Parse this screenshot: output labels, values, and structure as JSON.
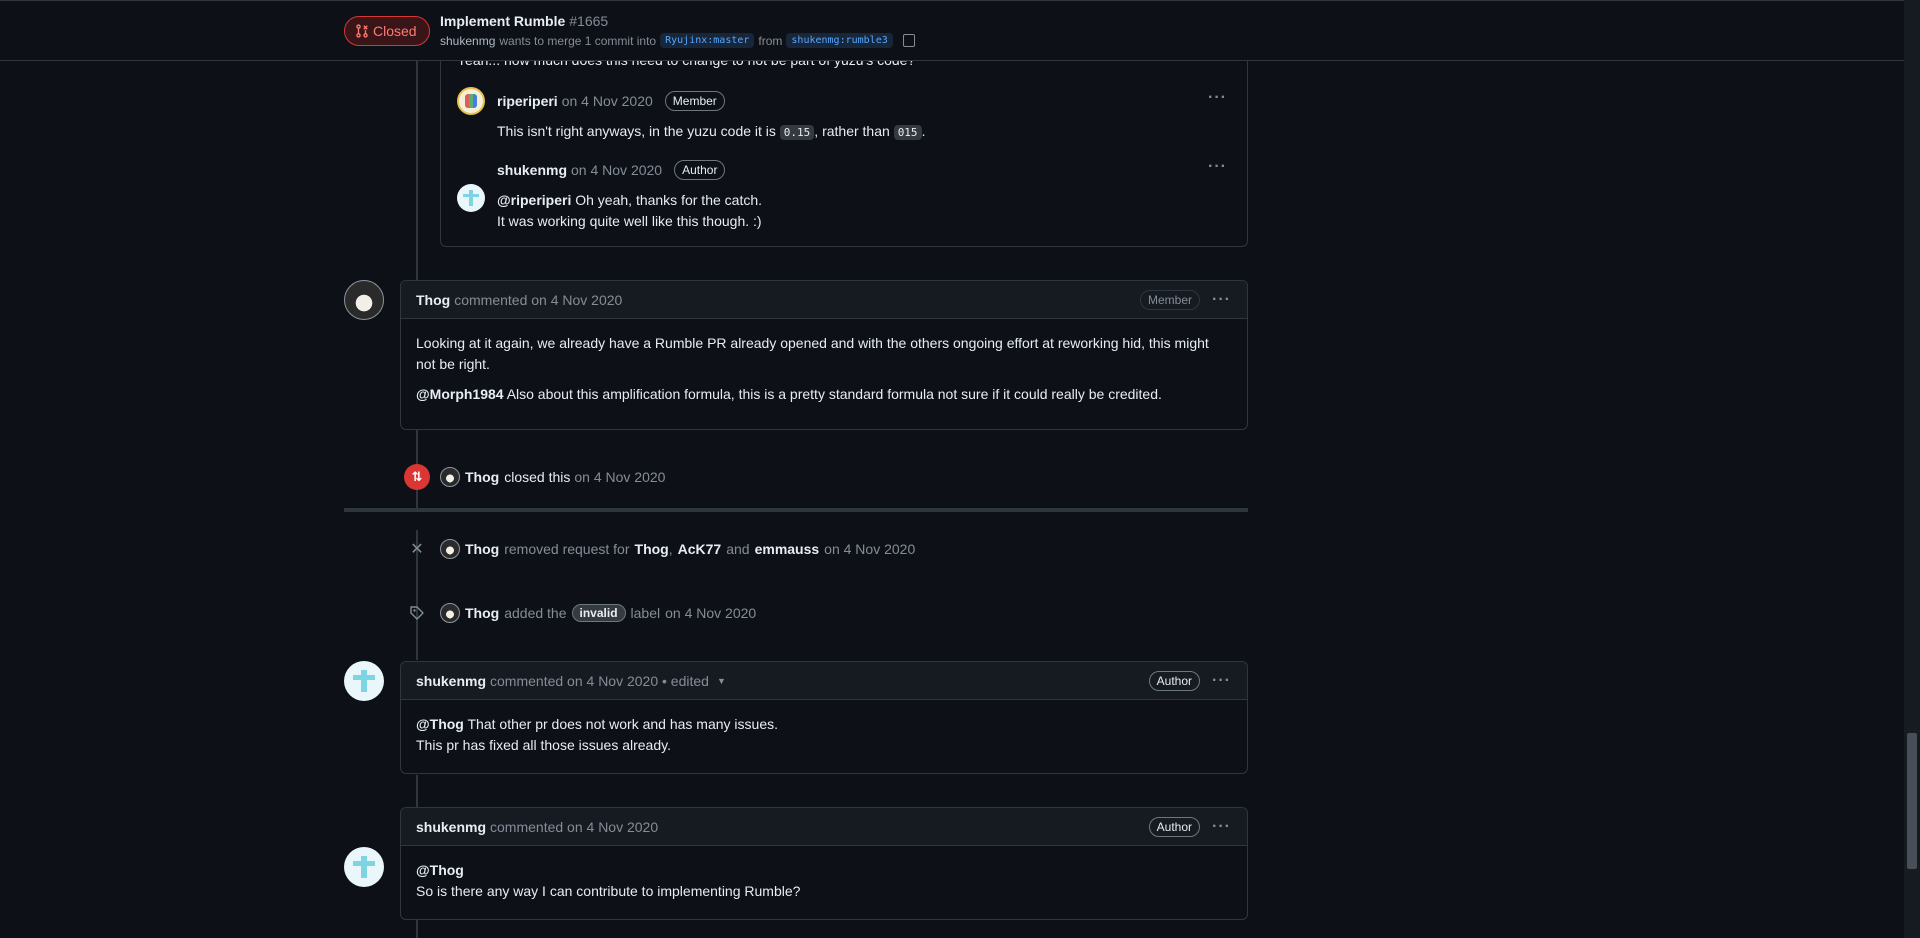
{
  "header": {
    "state": "Closed",
    "title": "Implement Rumble",
    "number": "#1665",
    "author": "shukenmg",
    "merge_text": "wants to merge 1 commit into",
    "base_branch": "Ryujinx:master",
    "from_text": "from",
    "head_branch": "shukenmg:rumble3"
  },
  "review_thread": {
    "truncated_text": "Yeah... how much does this need to change to not be part of yuzu's code?",
    "comments": [
      {
        "author": "riperiperi",
        "date": "on 4 Nov 2020",
        "role": "Member",
        "text_before": "This isn't right anyways, in the yuzu code it is",
        "code1": "0.15",
        "text_mid": ", rather than",
        "code2": "015",
        "text_after": "."
      },
      {
        "author": "shukenmg",
        "date": "on 4 Nov 2020",
        "role": "Author",
        "mention": "@riperiperi",
        "line1": "Oh yeah, thanks for the catch.",
        "line2": "It was working quite well like this though. :)"
      }
    ]
  },
  "comment_thog": {
    "author": "Thog",
    "meta": "commented on 4 Nov 2020",
    "role": "Member",
    "para1": "Looking at it again, we already have a Rumble PR already opened and with the others ongoing effort at reworking hid, this might not be right.",
    "mention": "@Morph1984",
    "para2": "Also about this amplification formula, this is a pretty standard formula not sure if it could really be credited."
  },
  "event_closed": {
    "actor": "Thog",
    "action": "closed this",
    "date": "on 4 Nov 2020"
  },
  "event_review_removed": {
    "actor": "Thog",
    "action": "removed request for",
    "reviewer1": "Thog",
    "sep": ",",
    "reviewer2": "AcK77",
    "and": "and",
    "reviewer3": "emmauss",
    "date": "on 4 Nov 2020"
  },
  "event_label": {
    "actor": "Thog",
    "action": "added the",
    "label": "invalid",
    "suffix": "label",
    "date": "on 4 Nov 2020"
  },
  "comment_shuk1": {
    "author": "shukenmg",
    "meta": "commented on 4 Nov 2020 • edited",
    "role": "Author",
    "mention": "@Thog",
    "line1": "That other pr does not work and has many issues.",
    "line2": "This pr has fixed all those issues already."
  },
  "comment_shuk2": {
    "author": "shukenmg",
    "meta": "commented on 4 Nov 2020",
    "role": "Author",
    "mention": "@Thog",
    "line2": "So is there any way I can contribute to implementing Rumble?"
  },
  "icons": {
    "closed_pr": "git-pull-request-closed-icon",
    "copy": "copy-icon",
    "kebab": "kebab-horizontal-icon",
    "x": "x-icon",
    "tag": "tag-icon",
    "caret": "triangle-down-icon"
  },
  "colors": {
    "background": "#0d1117",
    "closed_red": "#da3633",
    "link_blue": "#58a6ff"
  }
}
